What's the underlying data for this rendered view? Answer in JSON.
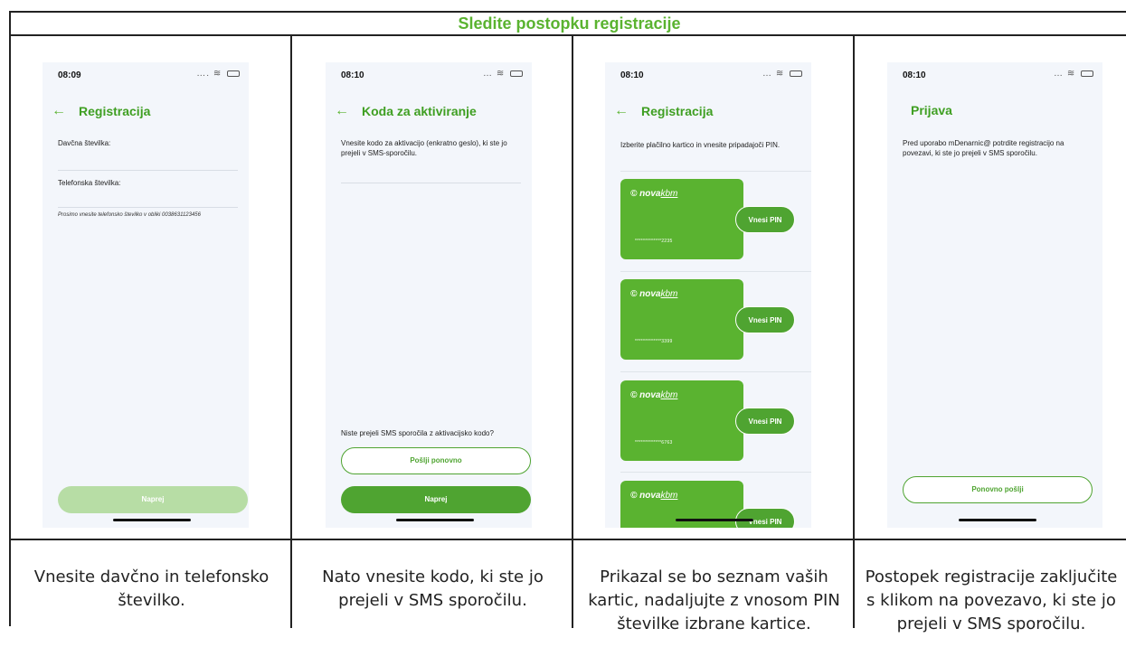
{
  "header": {
    "title": "Sledite postopku registracije"
  },
  "status_icons": {
    "signal": "....",
    "wifi": "wifi-icon",
    "battery": "battery-icon"
  },
  "colors": {
    "brand_green": "#5ab330",
    "button_green": "#4fa431",
    "disabled_green": "#b7dda5",
    "screen_bg": "#f3f6fb"
  },
  "steps": [
    {
      "time": "08:09",
      "title": "Registracija",
      "tax_label": "Davčna številka:",
      "phone_label": "Telefonska številka:",
      "phone_hint": "Prosimo vnesite telefonsko številko v obliki 0038631123456",
      "next_label": "Naprej",
      "caption": "Vnesite davčno in telefonsko številko."
    },
    {
      "time": "08:10",
      "title": "Koda za aktiviranje",
      "instruction": "Vnesite kodo za aktivacijo (enkratno geslo), ki ste jo prejeli v SMS-sporočilu.",
      "no_sms_text": "Niste prejeli SMS sporočila z aktivacijsko kodo?",
      "resend_label": "Pošlji ponovno",
      "next_label": "Naprej",
      "caption": "Nato vnesite kodo, ki ste jo prejeli v SMS sporočilu."
    },
    {
      "time": "08:10",
      "title": "Registracija",
      "instruction": "Izberite plačilno kartico in vnesite pripadajoči PIN.",
      "cards": [
        {
          "logo_main": "nova",
          "logo_kbm": "kbm",
          "number": "*************2235",
          "pin_label": "Vnesi PIN"
        },
        {
          "logo_main": "nova",
          "logo_kbm": "kbm",
          "number": "*************3399",
          "pin_label": "Vnesi PIN"
        },
        {
          "logo_main": "nova",
          "logo_kbm": "kbm",
          "number": "*************6763",
          "pin_label": "Vnesi PIN"
        },
        {
          "logo_main": "nova",
          "logo_kbm": "kbm",
          "number": "",
          "pin_label": "Vnesi PIN"
        }
      ],
      "caption": "Prikazal se bo seznam vaših kartic, nadaljujte z vnosom PIN številke izbrane kartice."
    },
    {
      "time": "08:10",
      "title": "Prijava",
      "instruction": "Pred uporabo mDenarnic@ potrdite registracijo na povezavi, ki ste jo prejeli v SMS sporočilu.",
      "resend_label": "Ponovno pošlji",
      "caption": "Postopek registracije zaključite s klikom na povezavo, ki ste jo prejeli v SMS sporočilu."
    }
  ]
}
